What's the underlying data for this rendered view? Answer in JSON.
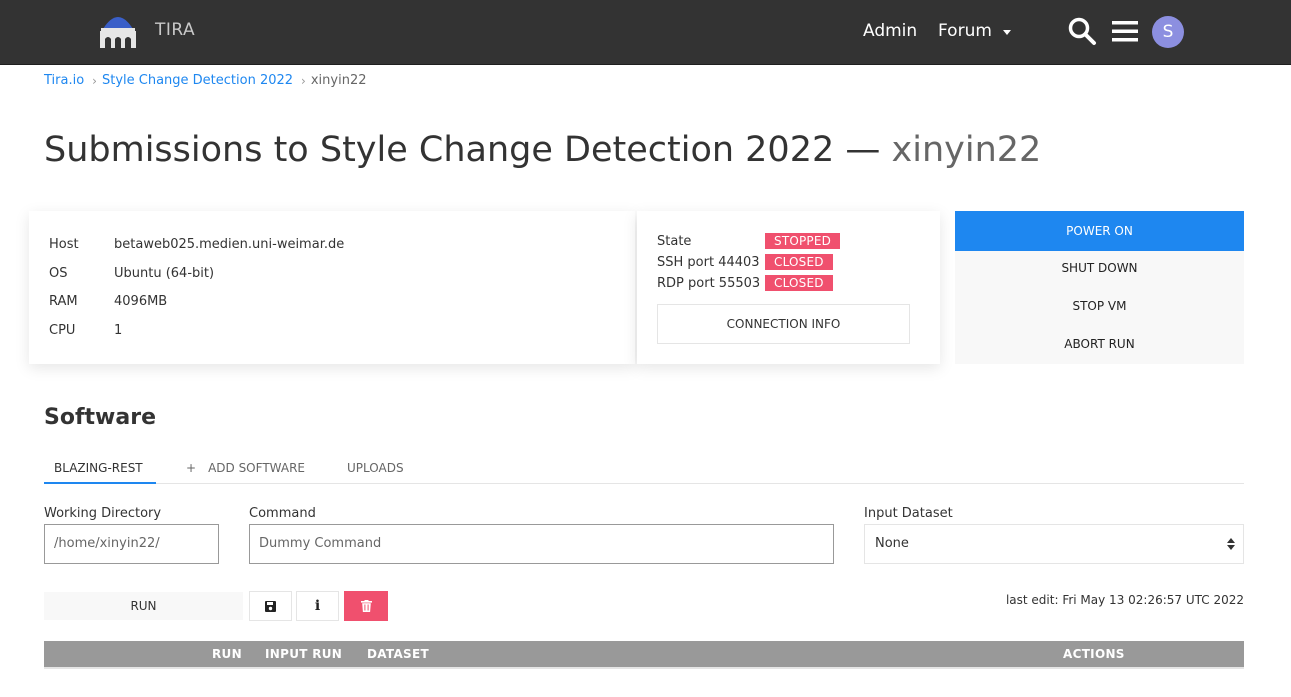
{
  "header": {
    "brand": "TIRA",
    "nav": {
      "admin": "Admin",
      "forum": "Forum"
    },
    "avatar_initial": "S",
    "icons": [
      "logo-icon",
      "search-icon",
      "menu-icon",
      "caret-down-icon"
    ]
  },
  "breadcrumb": {
    "items": [
      "Tira.io",
      "Style Change Detection 2022",
      "xinyin22"
    ],
    "separator": "›"
  },
  "page": {
    "title": "Submissions to Style Change Detection 2022 —",
    "title_user": "xinyin22"
  },
  "vm": {
    "rows": [
      {
        "key": "Host",
        "value": "betaweb025.medien.uni-weimar.de"
      },
      {
        "key": "OS",
        "value": "Ubuntu (64-bit)"
      },
      {
        "key": "RAM",
        "value": "4096MB"
      },
      {
        "key": "CPU",
        "value": "1"
      }
    ],
    "state": [
      {
        "key": "State",
        "value": "STOPPED"
      },
      {
        "key": "SSH port 44403",
        "value": "CLOSED"
      },
      {
        "key": "RDP port 55503",
        "value": "CLOSED"
      }
    ],
    "connection_info": "CONNECTION INFO",
    "actions": {
      "power_on": "POWER ON",
      "shut_down": "SHUT DOWN",
      "stop_vm": "STOP VM",
      "abort_run": "ABORT RUN"
    }
  },
  "software": {
    "title": "Software",
    "tabs": {
      "active": "BLAZING-REST",
      "add_icon": "+",
      "add": "ADD SOFTWARE",
      "uploads": "UPLOADS"
    },
    "fields": {
      "working_dir_label": "Working Directory",
      "working_dir_value": "/home/xinyin22/",
      "command_label": "Command",
      "command_value": "Dummy Command",
      "dataset_label": "Input Dataset",
      "dataset_value": "None"
    },
    "run_label": "RUN",
    "info_glyph": "i",
    "last_edit": "last edit: Fri May 13 02:26:57 UTC 2022"
  },
  "runs_table": {
    "columns": [
      "RUN",
      "INPUT RUN",
      "DATASET",
      "ACTIONS"
    ]
  },
  "colors": {
    "topbar": "#333333",
    "primary": "#1e87f0",
    "danger": "#f0506e",
    "avatar": "#8c8fe0",
    "table_header": "#999999"
  }
}
